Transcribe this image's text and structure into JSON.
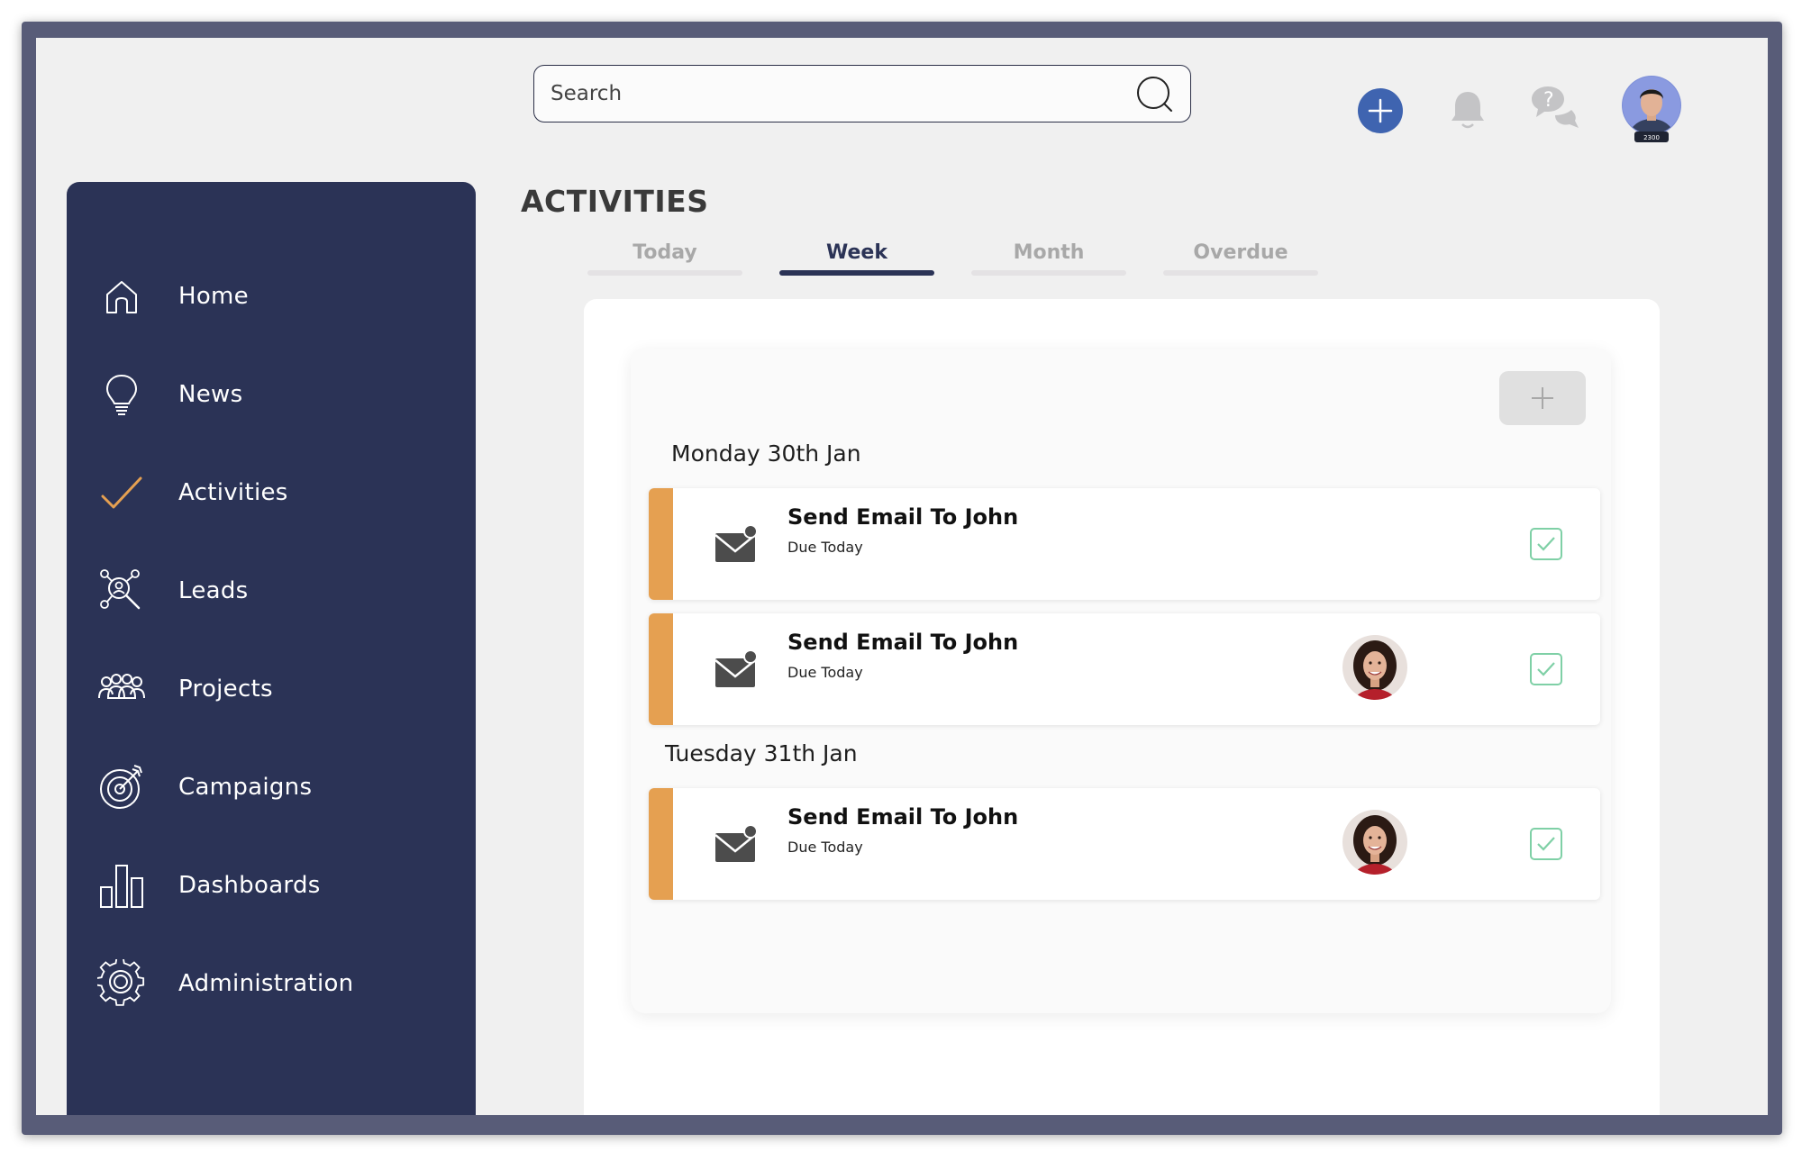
{
  "search": {
    "placeholder": "Search"
  },
  "top_bar": {
    "add_icon": "plus-icon",
    "notification_icon": "bell-icon",
    "help_icon": "help-chat-icon",
    "user_badge": "2300"
  },
  "sidebar": {
    "items": [
      {
        "label": "Home",
        "icon": "home-icon"
      },
      {
        "label": "News",
        "icon": "lightbulb-icon"
      },
      {
        "label": "Activities",
        "icon": "checkmark-icon",
        "active": true
      },
      {
        "label": "Leads",
        "icon": "leads-network-icon"
      },
      {
        "label": "Projects",
        "icon": "people-group-icon"
      },
      {
        "label": "Campaigns",
        "icon": "target-icon"
      },
      {
        "label": "Dashboards",
        "icon": "bar-chart-icon"
      },
      {
        "label": "Administration",
        "icon": "gear-icon"
      }
    ]
  },
  "main": {
    "title": "ACTIVITIES",
    "tabs": [
      {
        "label": "Today"
      },
      {
        "label": "Week",
        "active": true
      },
      {
        "label": "Month"
      },
      {
        "label": "Overdue"
      }
    ],
    "groups": [
      {
        "day": "Monday 30th Jan",
        "activities": [
          {
            "title": "Send Email To John",
            "due": "Due Today",
            "has_avatar": false
          },
          {
            "title": "Send Email To John",
            "due": "Due Today",
            "has_avatar": true
          }
        ]
      },
      {
        "day": "Tuesday 31th Jan",
        "activities": [
          {
            "title": "Send Email To John",
            "due": "Due Today",
            "has_avatar": true
          }
        ]
      }
    ]
  },
  "colors": {
    "sidebar_bg": "#2b3356",
    "accent_orange": "#e5a051",
    "primary_blue": "#3f64b0",
    "check_green": "#7fd0a6"
  }
}
